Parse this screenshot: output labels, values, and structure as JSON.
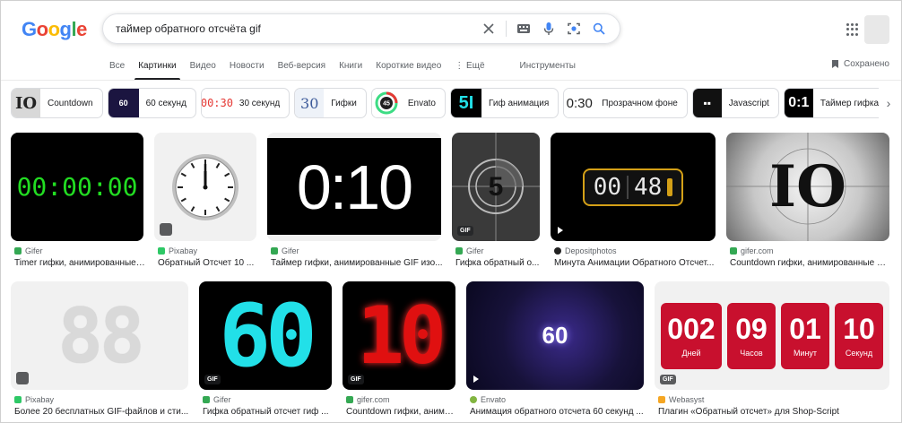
{
  "brand": {
    "logo_letters": [
      "G",
      "o",
      "o",
      "g",
      "l",
      "e"
    ],
    "logo_colors": [
      "#4285f4",
      "#ea4335",
      "#fbbc05",
      "#4285f4",
      "#34a853",
      "#ea4335"
    ]
  },
  "search": {
    "query": "таймер обратного отсчёта gif",
    "clear_icon": "close-icon",
    "keyboard_icon": "keyboard-icon",
    "voice_icon": "mic-icon",
    "lens_icon": "lens-icon",
    "search_icon": "search-icon"
  },
  "tabs": [
    {
      "label": "Все",
      "active": false
    },
    {
      "label": "Картинки",
      "active": true
    },
    {
      "label": "Видео",
      "active": false
    },
    {
      "label": "Новости",
      "active": false
    },
    {
      "label": "Веб-версия",
      "active": false
    },
    {
      "label": "Книги",
      "active": false
    },
    {
      "label": "Короткие видео",
      "active": false
    },
    {
      "label": "⋮ Ещё",
      "active": false
    }
  ],
  "tools_label": "Инструменты",
  "saved_label": "Сохранено",
  "chips": [
    {
      "label": "Countdown",
      "thumb_text": "IO",
      "thumb_bg": "#d8d8d8",
      "thumb_fg": "#222222"
    },
    {
      "label": "60 секунд",
      "thumb_text": "60",
      "thumb_bg": "#1b1540",
      "thumb_fg": "#ffffff"
    },
    {
      "label": "30 секунд",
      "thumb_text": "00:30",
      "thumb_bg": "#ffffff",
      "thumb_fg": "#e53935"
    },
    {
      "label": "Гифки",
      "thumb_text": "30",
      "thumb_bg": "#eef2f8",
      "thumb_fg": "#3c5a99"
    },
    {
      "label": "Envato",
      "thumb_text": "45",
      "thumb_bg": "#ffffff",
      "thumb_fg": "#444444"
    },
    {
      "label": "Гиф анимация",
      "thumb_text": "5I",
      "thumb_bg": "#000000",
      "thumb_fg": "#22e0e8"
    },
    {
      "label": "Прозрачном фоне",
      "thumb_text": "0:30",
      "thumb_bg": "#ffffff",
      "thumb_fg": "#222222"
    },
    {
      "label": "Javascript",
      "thumb_text": "▪▪",
      "thumb_bg": "#111111",
      "thumb_fg": "#ffffff"
    },
    {
      "label": "Таймер гифка обрат",
      "thumb_text": "0:1",
      "thumb_bg": "#000000",
      "thumb_fg": "#ffffff"
    }
  ],
  "results": [
    {
      "source": "Gifer",
      "title": "Timer гифки, анимированные ...",
      "fav_color": "#34a853",
      "badge": "",
      "play": false
    },
    {
      "source": "Pixabay",
      "title": "Обратный Отсчет 10 ...",
      "fav_color": "#2ec866",
      "badge": "",
      "play": false
    },
    {
      "source": "Gifer",
      "title": "Таймер гифки, анимированные GIF изо...",
      "fav_color": "#34a853",
      "badge": "",
      "play": false
    },
    {
      "source": "Gifer",
      "title": "Гифка обратный о...",
      "fav_color": "#34a853",
      "badge": "GIF",
      "play": false
    },
    {
      "source": "Depositphotos",
      "title": "Минута Анимации Обратного Отсчет...",
      "fav_color": "#222222",
      "badge": "",
      "play": true
    },
    {
      "source": "gifer.com",
      "title": "Countdown гифки, анимированные G...",
      "fav_color": "#34a853",
      "badge": "",
      "play": false
    },
    {
      "source": "Pixabay",
      "title": "Более 20 бесплатных GIF-файлов и сти...",
      "fav_color": "#2ec866",
      "badge": "",
      "play": false
    },
    {
      "source": "Gifer",
      "title": "Гифка обратный отсчет гиф ...",
      "fav_color": "#34a853",
      "badge": "GIF",
      "play": false
    },
    {
      "source": "gifer.com",
      "title": "Countdown гифки, анимирова...",
      "fav_color": "#34a853",
      "badge": "GIF",
      "play": false
    },
    {
      "source": "Envato",
      "title": "Анимация обратного отсчета 60 секунд ...",
      "fav_color": "#82b541",
      "badge": "",
      "play": true
    },
    {
      "source": "Webasyst",
      "title": "Плагин «Обратный отсчет» для Shop-Script",
      "fav_color": "#f5a623",
      "badge": "GIF",
      "play": false
    }
  ],
  "images": {
    "timer_green": "00:00:00",
    "timer_white": "0:10",
    "timer_five": "5",
    "timer_banner_left": "00",
    "timer_banner_right": "48",
    "timer_ten": "IO",
    "timer_eighty": "88",
    "timer_sixty_cyan": "60",
    "timer_ten_red": "10",
    "timer_sixty_purple": "60",
    "countdown_values": [
      "002",
      "09",
      "01",
      "10"
    ],
    "countdown_labels": [
      "Дней",
      "Часов",
      "Минут",
      "Секунд"
    ]
  },
  "colors": {
    "accent_green": "#22dd22",
    "neon_cyan": "#22e0e8",
    "neon_red": "#e01010",
    "countdown_red": "#c8102e",
    "gold": "#d4a017"
  }
}
